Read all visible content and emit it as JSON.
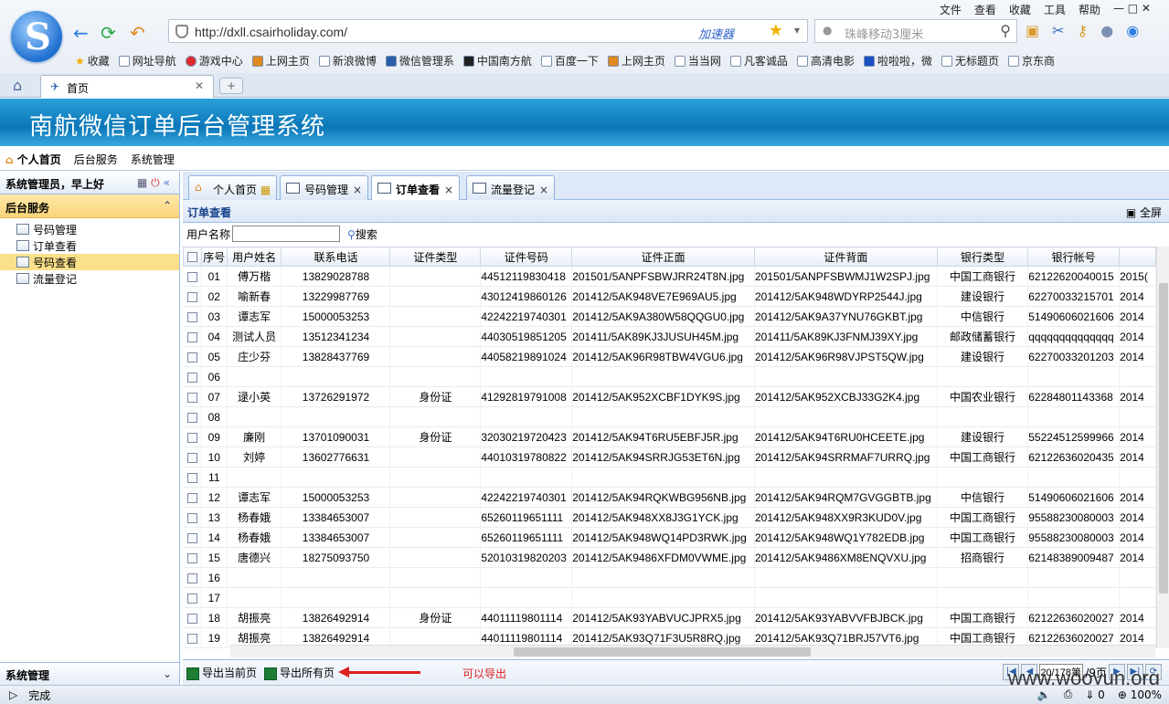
{
  "browser": {
    "menu": [
      "文件",
      "查看",
      "收藏",
      "工具",
      "帮助"
    ],
    "url": "http://dxll.csairholiday.com/",
    "accelerator_label": "加速器",
    "search_placeholder": "珠峰移动3厘米",
    "bookmarks": [
      "收藏",
      "网址导航",
      "游戏中心",
      "上网主页",
      "新浪微博",
      "微信管理系",
      "中国南方航",
      "百度一下",
      "上网主页",
      "当当网",
      "凡客诚品",
      "高清电影",
      "啦啦啦，微",
      "无标题页",
      "京东商"
    ],
    "tab_title": "首页",
    "new_tab": "+",
    "status_text": "完成",
    "status_count": "0",
    "zoom": "100%"
  },
  "app": {
    "title": "南航微信订单后台管理系统",
    "topnav": [
      "个人首页",
      "后台服务",
      "系统管理"
    ],
    "greeting": "系统管理员，早上好",
    "section_title": "后台服务",
    "tree": [
      "号码管理",
      "订单查看",
      "号码查看",
      "流量登记"
    ],
    "tree_selected_index": 2,
    "bottom_section": "系统管理"
  },
  "tabs": [
    {
      "label": "个人首页",
      "closable": false,
      "active": false
    },
    {
      "label": "号码管理",
      "closable": true,
      "active": false
    },
    {
      "label": "订单查看",
      "closable": true,
      "active": true
    },
    {
      "label": "流量登记",
      "closable": true,
      "active": false
    }
  ],
  "panel": {
    "title": "订单查看",
    "fullscreen_label": "全屏",
    "search_label": "用户名称",
    "search_value": "",
    "search_button": "搜索"
  },
  "grid": {
    "columns": [
      "序号",
      "用户姓名",
      "联系电话",
      "证件类型",
      "证件号码",
      "证件正面",
      "证件背面",
      "银行类型",
      "银行帐号",
      ""
    ],
    "rows": [
      [
        "01",
        "傅万楷",
        "13829028788",
        "",
        "44512119830418",
        "201501/5ANPFSBWJRR24T8N.jpg",
        "201501/5ANPFSBWMJ1W2SPJ.jpg",
        "中国工商银行",
        "62122620040015",
        "2015("
      ],
      [
        "02",
        "喻新春",
        "13229987769",
        "",
        "43012419860126",
        "201412/5AK948VE7E969AU5.jpg",
        "201412/5AK948WDYRP2544J.jpg",
        "建设银行",
        "62270033215701",
        "2014"
      ],
      [
        "03",
        "谭志军",
        "15000053253",
        "",
        "42242219740301",
        "201412/5AK9A380W58QQGU0.jpg",
        "201412/5AK9A37YNU76GKBT.jpg",
        "中信银行",
        "51490606021606",
        "2014"
      ],
      [
        "04",
        "测试人员",
        "13512341234",
        "",
        "44030519851205",
        "201411/5AK89KJ3JUSUH45M.jpg",
        "201411/5AK89KJ3FNMJ39XY.jpg",
        "邮政储蓄银行",
        "qqqqqqqqqqqqqq",
        "2014"
      ],
      [
        "05",
        "庄少芬",
        "13828437769",
        "",
        "44058219891024",
        "201412/5AK96R98TBW4VGU6.jpg",
        "201412/5AK96R98VJPST5QW.jpg",
        "建设银行",
        "62270033201203",
        "2014"
      ],
      [
        "06",
        "",
        "",
        "",
        "",
        "",
        "",
        "",
        "",
        ""
      ],
      [
        "07",
        "逯小英",
        "13726291972",
        "身份证",
        "41292819791008",
        "201412/5AK952XCBF1DYK9S.jpg",
        "201412/5AK952XCBJ33G2K4.jpg",
        "中国农业银行",
        "62284801143368",
        "2014"
      ],
      [
        "08",
        "",
        "",
        "",
        "",
        "",
        "",
        "",
        "",
        ""
      ],
      [
        "09",
        "廉刚",
        "13701090031",
        "身份证",
        "32030219720423",
        "201412/5AK94T6RU5EBFJ5R.jpg",
        "201412/5AK94T6RU0HCEETE.jpg",
        "建设银行",
        "55224512599966",
        "2014"
      ],
      [
        "10",
        "刘婷",
        "13602776631",
        "",
        "44010319780822",
        "201412/5AK94SRRJG53ET6N.jpg",
        "201412/5AK94SRRMAF7URRQ.jpg",
        "中国工商银行",
        "62122636020435",
        "2014"
      ],
      [
        "11",
        "",
        "",
        "",
        "",
        "",
        "",
        "",
        "",
        ""
      ],
      [
        "12",
        "谭志军",
        "15000053253",
        "",
        "42242219740301",
        "201412/5AK94RQKWBG956NB.jpg",
        "201412/5AK94RQM7GVGGBTB.jpg",
        "中信银行",
        "51490606021606",
        "2014"
      ],
      [
        "13",
        "杨春娥",
        "13384653007",
        "",
        "65260119651111",
        "201412/5AK948XX8J3G1YCK.jpg",
        "201412/5AK948XX9R3KUD0V.jpg",
        "中国工商银行",
        "95588230080003",
        "2014"
      ],
      [
        "14",
        "杨春娥",
        "13384653007",
        "",
        "65260119651111",
        "201412/5AK948WQ14PD3RWK.jpg",
        "201412/5AK948WQ1Y782EDB.jpg",
        "中国工商银行",
        "95588230080003",
        "2014"
      ],
      [
        "15",
        "唐德兴",
        "18275093750",
        "",
        "52010319820203",
        "201412/5AK9486XFDM0VWME.jpg",
        "201412/5AK9486XM8ENQVXU.jpg",
        "招商银行",
        "62148389009487",
        "2014"
      ],
      [
        "16",
        "",
        "",
        "",
        "",
        "",
        "",
        "",
        "",
        ""
      ],
      [
        "17",
        "",
        "",
        "",
        "",
        "",
        "",
        "",
        "",
        ""
      ],
      [
        "18",
        "胡振亮",
        "13826492914",
        "身份证",
        "44011119801114",
        "201412/5AK93YABVUCJPRX5.jpg",
        "201412/5AK93YABVVFBJBCK.jpg",
        "中国工商银行",
        "62122636020027",
        "2014"
      ],
      [
        "19",
        "胡振亮",
        "13826492914",
        "",
        "44011119801114",
        "201412/5AK93Q71F3U5R8RQ.jpg",
        "201412/5AK93Q71BRJ57VT6.jpg",
        "中国工商银行",
        "62122636020027",
        "2014"
      ],
      [
        "20",
        "",
        "",
        "",
        "",
        "",
        "",
        "",
        "",
        ""
      ]
    ]
  },
  "footer": {
    "export_current": "导出当前页",
    "export_all": "导出所有页",
    "note": "可以导出",
    "page_input": "20/178第",
    "page_label": "/9页",
    "watermark": "www.wooyun.org"
  },
  "colors": {
    "header": "#1a8ccb",
    "accent_red": "#e02020",
    "selected": "#fbe08a"
  }
}
